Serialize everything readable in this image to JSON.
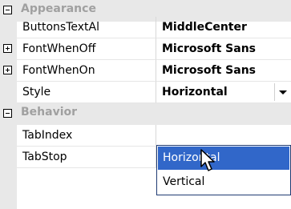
{
  "categories": {
    "appearance": "Appearance",
    "behavior": "Behavior"
  },
  "properties": [
    {
      "name": "ButtonsTextAl",
      "value": "MiddleCenter"
    },
    {
      "name": "FontWhenOff",
      "value": "Microsoft Sans"
    },
    {
      "name": "FontWhenOn",
      "value": "Microsoft Sans"
    },
    {
      "name": "Style",
      "value": "Horizontal"
    },
    {
      "name": "TabIndex",
      "value": ""
    },
    {
      "name": "TabStop",
      "value": ""
    }
  ],
  "dropdown": {
    "options": [
      "Horizontal",
      "Vertical"
    ],
    "selected_index": 0
  },
  "icons": {
    "expand": "plus-box-icon",
    "collapse": "minus-box-icon",
    "dropdown": "chevron-down-icon",
    "cursor": "arrow-cursor-icon"
  },
  "colors": {
    "selection": "#3167c9",
    "category_bg": "#e8e8e8",
    "category_text": "#a0a0a0"
  }
}
